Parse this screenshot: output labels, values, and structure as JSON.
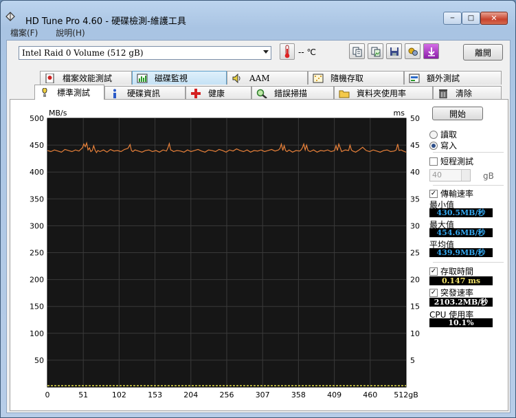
{
  "window": {
    "title": "HD Tune Pro 4.60 - 硬碟檢測-維護工具",
    "controls": {
      "minimize": "─",
      "maximize": "□",
      "close": "✕"
    }
  },
  "menu": [
    "檔案(F)",
    "說明(H)"
  ],
  "toolbar": {
    "drive": "Intel   Raid 0 Volume (512 gB)",
    "temperature": "-- ℃",
    "exit_label": "離開",
    "icons": [
      "copy-text-icon",
      "copy-image-icon",
      "save-icon",
      "options-icon",
      "download-icon"
    ]
  },
  "tabs_row1": [
    {
      "label": "檔案效能測試",
      "icon": "file-benchmark-icon"
    },
    {
      "label": "磁碟監視",
      "icon": "disk-monitor-icon"
    },
    {
      "label": "AAM",
      "icon": "speaker-icon"
    },
    {
      "label": "隨機存取",
      "icon": "random-access-icon"
    },
    {
      "label": "額外測試",
      "icon": "extra-tests-icon"
    }
  ],
  "tabs_row2": [
    {
      "label": "標準測試",
      "icon": "benchmark-icon"
    },
    {
      "label": "硬碟資訊",
      "icon": "info-icon"
    },
    {
      "label": "健康",
      "icon": "health-icon"
    },
    {
      "label": "錯誤掃描",
      "icon": "error-scan-icon"
    },
    {
      "label": "資料夾使用率",
      "icon": "folder-usage-icon"
    },
    {
      "label": "清除",
      "icon": "erase-icon"
    }
  ],
  "panel": {
    "start": "開始",
    "read": "讀取",
    "write": "寫入",
    "mode": "write",
    "short_test": "短程測試",
    "short_test_checked": false,
    "short_value": "40",
    "short_unit": "gB",
    "transfer_rate": "傳輸速率",
    "transfer_checked": true,
    "min_label": "最小值",
    "min_value": "430.5MB/秒",
    "max_label": "最大值",
    "max_value": "454.6MB/秒",
    "avg_label": "平均值",
    "avg_value": "439.9MB/秒",
    "access_time": "存取時間",
    "access_checked": true,
    "access_value": "0.147 ms",
    "burst_rate": "突發速率",
    "burst_checked": true,
    "burst_value": "2103.2MB/秒",
    "cpu_label": "CPU 使用率",
    "cpu_value": "10.1%"
  },
  "chart_data": {
    "type": "line",
    "ylabel_left": "MB/s",
    "ylabel_right": "ms",
    "ylim_left": [
      0,
      500
    ],
    "ylim_right": [
      0,
      50
    ],
    "yticks_left": [
      "500",
      "450",
      "400",
      "350",
      "300",
      "250",
      "200",
      "150",
      "100",
      "50"
    ],
    "yticks_right": [
      "50",
      "45",
      "40",
      "35",
      "30",
      "25",
      "20",
      "15",
      "10",
      "5"
    ],
    "xticks": [
      "0",
      "51",
      "102",
      "153",
      "204",
      "256",
      "307",
      "358",
      "409",
      "460",
      "512gB"
    ],
    "xlim": [
      0,
      512
    ],
    "colors": {
      "transfer": "#e8813a",
      "access": "#e8e24a",
      "grid": "#3a3a3a",
      "plot_bg": "#161616"
    },
    "series": [
      {
        "x": [
          0,
          5,
          10,
          15,
          20,
          25,
          30,
          35,
          40,
          45,
          50,
          52,
          54,
          56,
          58,
          60,
          62,
          64,
          66,
          68,
          70,
          72,
          75,
          80,
          85,
          90,
          95,
          100,
          105,
          110,
          115,
          118,
          120,
          122,
          125,
          130,
          135,
          140,
          145,
          150,
          155,
          160,
          165,
          170,
          172,
          174,
          176,
          178,
          180,
          185,
          190,
          195,
          200,
          205,
          210,
          215,
          220,
          225,
          230,
          235,
          240,
          245,
          250,
          255,
          260,
          265,
          270,
          275,
          280,
          285,
          290,
          295,
          300,
          305,
          310,
          315,
          320,
          325,
          330,
          332,
          334,
          336,
          338,
          340,
          342,
          345,
          350,
          355,
          360,
          362,
          364,
          366,
          368,
          370,
          372,
          375,
          380,
          385,
          390,
          395,
          400,
          405,
          410,
          412,
          414,
          416,
          420,
          425,
          430,
          432,
          434,
          436,
          440,
          445,
          450,
          455,
          460,
          465,
          470,
          475,
          480,
          485,
          490,
          495,
          498,
          500,
          502,
          505,
          508,
          512
        ],
        "values": [
          440,
          438,
          441,
          439,
          437,
          442,
          440,
          438,
          441,
          439,
          445,
          452,
          447,
          454,
          441,
          445,
          438,
          440,
          449,
          441,
          436,
          440,
          438,
          441,
          437,
          442,
          439,
          440,
          438,
          442,
          444,
          451,
          440,
          438,
          441,
          439,
          437,
          440,
          441,
          438,
          440,
          437,
          441,
          439,
          445,
          453,
          441,
          440,
          438,
          440,
          439,
          437,
          441,
          438,
          440,
          442,
          439,
          437,
          441,
          440,
          438,
          442,
          440,
          437,
          441,
          439,
          443,
          440,
          438,
          441,
          437,
          440,
          439,
          441,
          438,
          440,
          442,
          439,
          441,
          444,
          452,
          440,
          449,
          440,
          438,
          441,
          437,
          440,
          439,
          441,
          445,
          452,
          441,
          450,
          440,
          438,
          441,
          437,
          440,
          439,
          441,
          438,
          440,
          449,
          440,
          452,
          438,
          441,
          440,
          450,
          441,
          439,
          437,
          441,
          446,
          440,
          438,
          441,
          439,
          437,
          440,
          441,
          438,
          439,
          441,
          452,
          440,
          441,
          439,
          437
        ]
      }
    ]
  }
}
